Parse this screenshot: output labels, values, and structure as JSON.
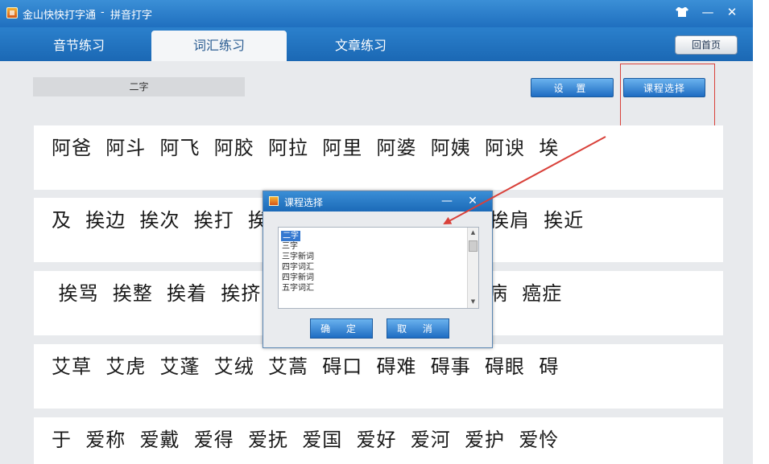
{
  "window": {
    "title": "金山快快打字通",
    "separator": "-",
    "subtitle": "拼音打字",
    "skin_icon": "shirt-icon",
    "minimize": "—",
    "close": "✕"
  },
  "tabs": [
    {
      "label": "音节练习"
    },
    {
      "label": "词汇练习",
      "active": true
    },
    {
      "label": "文章练习"
    }
  ],
  "home_button": "回首页",
  "current_course": "二字",
  "buttons": {
    "settings": "设 置",
    "course_select": "课程选择"
  },
  "word_rows": [
    "阿爸  阿斗  阿飞  阿胶  阿拉  阿里  阿婆  阿姨  阿谀  埃",
    "及  挨边  挨次  挨打  挨",
    " 挨骂  挨整  挨着  挨挤",
    "艾草  艾虎  艾蓬  艾绒  艾蒿  碍口  碍难  碍事  碍眼  碍",
    "于  爱称  爱戴  爱得  爱抚  爱国  爱好  爱河  爱护  爱怜"
  ],
  "word_rows_right": [
    "",
    "挨肩  挨近",
    "病  癌症",
    "",
    ""
  ],
  "dialog": {
    "title": "课程选择",
    "minimize": "—",
    "close": "✕",
    "items": [
      "二字",
      "三字",
      "三字新词",
      "四字词汇",
      "四字新词",
      "五字词汇"
    ],
    "selected_index": 0,
    "ok": "确 定",
    "cancel": "取 消"
  },
  "colors": {
    "titlebar": "#1f6fbf",
    "button_blue": "#1e6cc2",
    "highlight_red": "#d9413a"
  }
}
